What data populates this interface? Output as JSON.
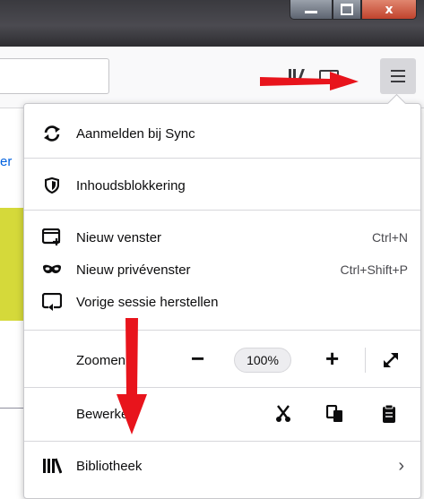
{
  "window": {
    "minimize_glyph": "",
    "close_glyph": "x"
  },
  "page": {
    "link_fragment": "er"
  },
  "menu": {
    "sync": {
      "label": "Aanmelden bij Sync",
      "icon": "sync-icon"
    },
    "content_blocking": {
      "label": "Inhoudsblokkering",
      "icon": "shield-icon"
    },
    "new_window": {
      "label": "Nieuw venster",
      "shortcut": "Ctrl+N",
      "icon": "new-window-icon"
    },
    "private_window": {
      "label": "Nieuw privévenster",
      "shortcut": "Ctrl+Shift+P",
      "icon": "private-mask-icon"
    },
    "restore_session": {
      "label": "Vorige sessie herstellen",
      "icon": "restore-session-icon"
    },
    "zoom": {
      "label": "Zoomen",
      "minus": "−",
      "value": "100%",
      "plus": "+"
    },
    "edit": {
      "label": "Bewerken"
    },
    "library": {
      "label": "Bibliotheek",
      "chevron": "›"
    }
  },
  "colors": {
    "annotation_arrow": "#e8141c",
    "accent_link": "#0060df",
    "page_band": "#d5d93a"
  }
}
